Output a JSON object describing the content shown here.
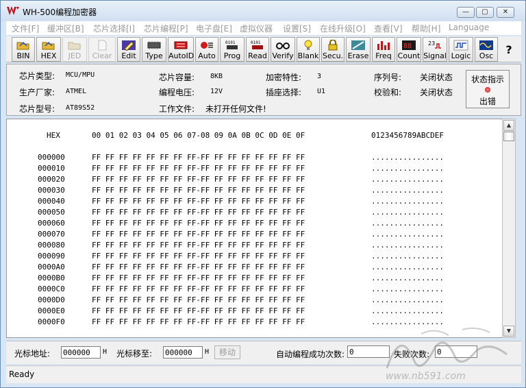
{
  "window": {
    "title": "WH-500编程加密器",
    "min_glyph": "—",
    "max_glyph": "▢",
    "close_glyph": "✕"
  },
  "menu": [
    "文件[F]",
    "缓冲区[B]",
    "芯片选择[I]",
    "芯片编程[P]",
    "电子盘[E]",
    "虚拟仪器",
    "设置[S]",
    "在线升级[O]",
    "查看[V]",
    "帮助[H]",
    "Language"
  ],
  "toolbar": [
    {
      "label": "BIN",
      "icon": "folder-open-icon",
      "enabled": true
    },
    {
      "label": "HEX",
      "icon": "folder-open-icon",
      "enabled": true
    },
    {
      "label": "JED",
      "icon": "folder-open-icon",
      "enabled": false
    },
    {
      "label": "Clear",
      "icon": "document-icon",
      "enabled": false
    },
    {
      "label": "Edit",
      "icon": "pen-icon",
      "enabled": true
    },
    {
      "label": "Type",
      "icon": "chip-icon",
      "enabled": true
    },
    {
      "label": "AutoID",
      "icon": "chip-red-icon",
      "enabled": true
    },
    {
      "label": "Auto",
      "icon": "auto-icon",
      "enabled": true
    },
    {
      "label": "Prog",
      "icon": "binary-prog-icon",
      "enabled": true
    },
    {
      "label": "Read",
      "icon": "binary-read-icon",
      "enabled": true
    },
    {
      "label": "Verify",
      "icon": "glasses-icon",
      "enabled": true
    },
    {
      "label": "Blank",
      "icon": "bulb-icon",
      "enabled": true
    },
    {
      "label": "Secu.",
      "icon": "lock-icon",
      "enabled": true
    },
    {
      "label": "Erase",
      "icon": "erase-icon",
      "enabled": true
    },
    {
      "label": "Freq",
      "icon": "freq-bars-icon",
      "enabled": true
    },
    {
      "label": "Count",
      "icon": "counter-icon",
      "enabled": true
    },
    {
      "label": "Signal",
      "icon": "signal-icon",
      "enabled": true
    },
    {
      "label": "Logic",
      "icon": "logic-icon",
      "enabled": true
    },
    {
      "label": "Osc",
      "icon": "oscilloscope-icon",
      "enabled": true
    },
    {
      "label": "?",
      "icon": "help-icon",
      "enabled": true
    }
  ],
  "info": {
    "chip_type_label": "芯片类型:",
    "chip_type_value": "MCU/MPU",
    "manufacturer_label": "生产厂家:",
    "manufacturer_value": "ATMEL",
    "chip_model_label": "芯片型号:",
    "chip_model_value": "AT89S52",
    "capacity_label": "芯片容量:",
    "capacity_value": "8KB",
    "voltage_label": "编程电压:",
    "voltage_value": "12V",
    "workfile_label": "工作文件:",
    "workfile_value": "未打开任何文件!",
    "encrypt_label": "加密特性:",
    "encrypt_value": "3",
    "socket_label": "插座选择:",
    "socket_value": "U1",
    "serial_label": "序列号:",
    "serial_value": "关闭状态",
    "checksum_label": "校验和:",
    "checksum_value": "关闭状态",
    "status_title": "状态指示",
    "status_value": "出错"
  },
  "hex": {
    "header_label": "HEX",
    "header_columns": "00 01 02 03 04 05 06 07-08 09 0A 0B 0C 0D 0E 0F",
    "ascii_header": "0123456789ABCDEF",
    "rows": [
      {
        "addr": "000000",
        "bytes": "FF FF FF FF FF FF FF FF-FF FF FF FF FF FF FF FF",
        "ascii": "................"
      },
      {
        "addr": "000010",
        "bytes": "FF FF FF FF FF FF FF FF-FF FF FF FF FF FF FF FF",
        "ascii": "................"
      },
      {
        "addr": "000020",
        "bytes": "FF FF FF FF FF FF FF FF-FF FF FF FF FF FF FF FF",
        "ascii": "................"
      },
      {
        "addr": "000030",
        "bytes": "FF FF FF FF FF FF FF FF-FF FF FF FF FF FF FF FF",
        "ascii": "................"
      },
      {
        "addr": "000040",
        "bytes": "FF FF FF FF FF FF FF FF-FF FF FF FF FF FF FF FF",
        "ascii": "................"
      },
      {
        "addr": "000050",
        "bytes": "FF FF FF FF FF FF FF FF-FF FF FF FF FF FF FF FF",
        "ascii": "................"
      },
      {
        "addr": "000060",
        "bytes": "FF FF FF FF FF FF FF FF-FF FF FF FF FF FF FF FF",
        "ascii": "................"
      },
      {
        "addr": "000070",
        "bytes": "FF FF FF FF FF FF FF FF-FF FF FF FF FF FF FF FF",
        "ascii": "................"
      },
      {
        "addr": "000080",
        "bytes": "FF FF FF FF FF FF FF FF-FF FF FF FF FF FF FF FF",
        "ascii": "................"
      },
      {
        "addr": "000090",
        "bytes": "FF FF FF FF FF FF FF FF-FF FF FF FF FF FF FF FF",
        "ascii": "................"
      },
      {
        "addr": "0000A0",
        "bytes": "FF FF FF FF FF FF FF FF-FF FF FF FF FF FF FF FF",
        "ascii": "................"
      },
      {
        "addr": "0000B0",
        "bytes": "FF FF FF FF FF FF FF FF-FF FF FF FF FF FF FF FF",
        "ascii": "................"
      },
      {
        "addr": "0000C0",
        "bytes": "FF FF FF FF FF FF FF FF-FF FF FF FF FF FF FF FF",
        "ascii": "................"
      },
      {
        "addr": "0000D0",
        "bytes": "FF FF FF FF FF FF FF FF-FF FF FF FF FF FF FF FF",
        "ascii": "................"
      },
      {
        "addr": "0000E0",
        "bytes": "FF FF FF FF FF FF FF FF-FF FF FF FF FF FF FF FF",
        "ascii": "................"
      },
      {
        "addr": "0000F0",
        "bytes": "FF FF FF FF FF FF FF FF-FF FF FF FF FF FF FF FF",
        "ascii": "................"
      }
    ]
  },
  "bottom": {
    "cursor_addr_label": "光标地址:",
    "cursor_addr_value": "000000",
    "h1": "H",
    "cursor_move_label": "光标移至:",
    "cursor_move_value": "000000",
    "h2": "H",
    "move_button": "移动",
    "success_label": "自动编程成功次数:",
    "success_value": "0",
    "fail_label": "失败次数:",
    "fail_value": "0"
  },
  "status_bar": {
    "text": "Ready"
  },
  "watermark": {
    "text": "www.nb591.com"
  },
  "colors": {
    "logo_red": "#c0141c",
    "led_red": "#d40000",
    "window_frame": "#d8e5f3"
  }
}
